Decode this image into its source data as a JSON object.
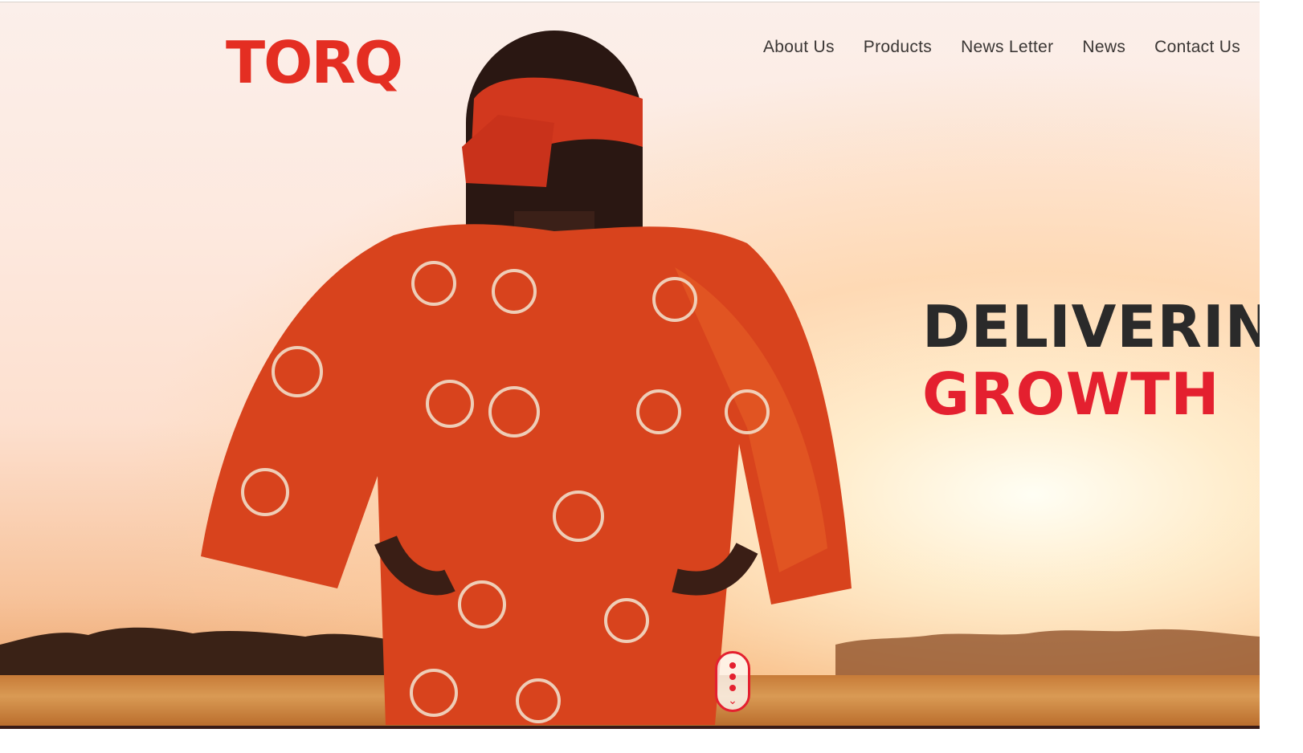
{
  "brand": {
    "logo_text": "TORQ",
    "accent_color": "#e42e22"
  },
  "nav": {
    "items": [
      {
        "label": "About Us"
      },
      {
        "label": "Products"
      },
      {
        "label": "News Letter"
      },
      {
        "label": "News"
      },
      {
        "label": "Contact Us"
      }
    ]
  },
  "hero": {
    "headline_line1": "DELIVERING",
    "headline_line2": "GROWTH",
    "headline_dark_color": "#2a2a2a",
    "headline_red_color": "#e4202f"
  },
  "scroll_indicator": {
    "icon": "scroll-down-icon"
  }
}
